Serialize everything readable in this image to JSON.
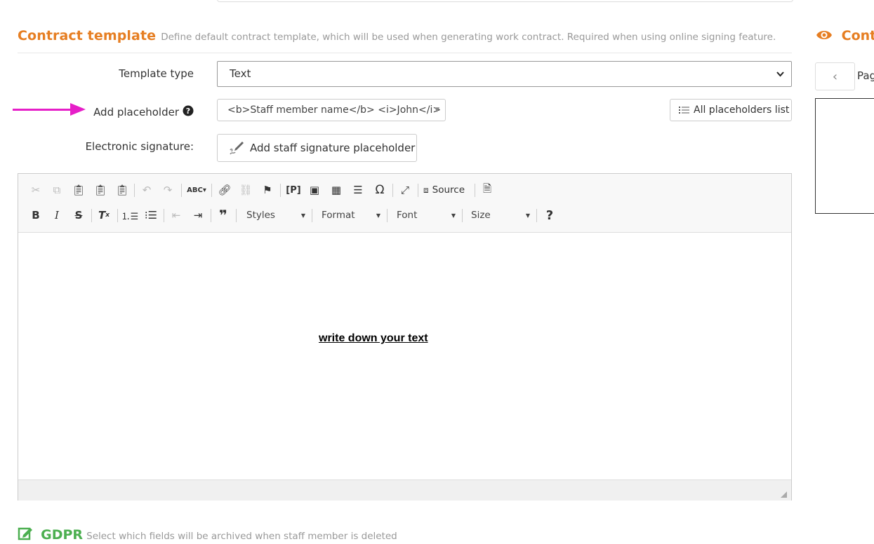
{
  "section": {
    "title": "Contract template",
    "description": "Define default contract template, which will be used when generating work contract. Required when using online signing feature."
  },
  "template_type": {
    "label": "Template type",
    "value": "Text"
  },
  "add_placeholder": {
    "label": "Add placeholder",
    "help_icon": "question-circle-icon",
    "value": "<b>Staff member name</b> <i>John</i>",
    "all_button": "All placeholders list"
  },
  "electronic_signature": {
    "label": "Electronic signature:",
    "button": "Add staff signature placeholder"
  },
  "editor": {
    "toolbar": {
      "source_label": "Source",
      "styles": "Styles",
      "format": "Format",
      "font": "Font",
      "size": "Size"
    },
    "content": "write down your text"
  },
  "gdpr": {
    "title": "GDPR",
    "description": "Select which fields will be archived when staff member is deleted"
  },
  "preview": {
    "title": "Contr",
    "pager_label": "Pag"
  },
  "colors": {
    "accent": "#E67E22",
    "gdpr": "#4CAF50",
    "annotation_arrow": "#E61EC8"
  }
}
